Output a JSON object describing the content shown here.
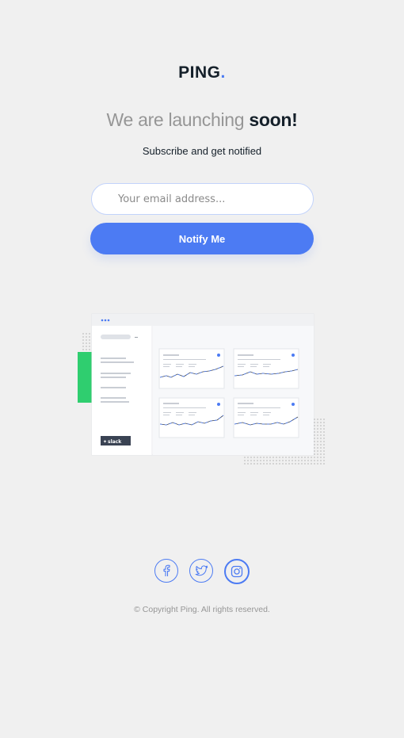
{
  "brand": {
    "name": "PING",
    "dot": "."
  },
  "headline": {
    "prefix": "We are launching ",
    "emphasis": "soon!"
  },
  "subheadline": "Subscribe and get notified",
  "form": {
    "email_placeholder": "Your email address...",
    "submit_label": "Notify Me"
  },
  "illustration": {
    "sidebar_button_label": "slack"
  },
  "social": [
    {
      "name": "facebook",
      "icon": "facebook-icon"
    },
    {
      "name": "twitter",
      "icon": "twitter-icon"
    },
    {
      "name": "instagram",
      "icon": "instagram-icon"
    }
  ],
  "footer": {
    "copyright": "© Copyright Ping. All rights reserved."
  },
  "colors": {
    "accent": "#4c7bf3",
    "dark": "#15202a",
    "gray": "#969696",
    "background": "#f0f0f0",
    "green": "#2fce6f"
  }
}
